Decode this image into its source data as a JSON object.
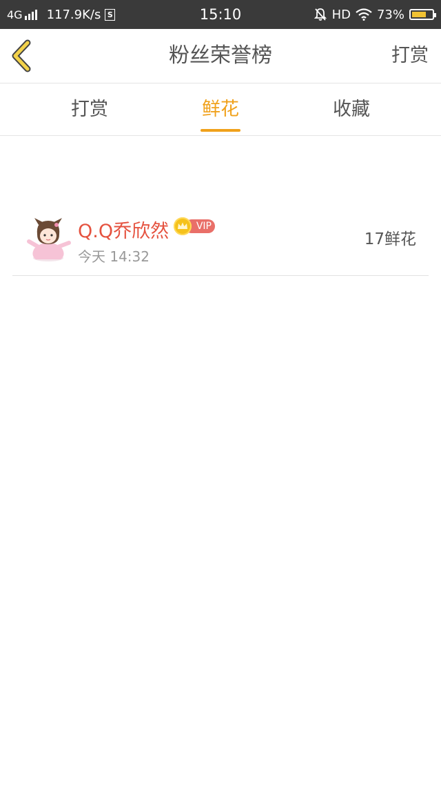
{
  "status_bar": {
    "network": "4G",
    "speed": "117.9K/s",
    "s_icon": "S",
    "time": "15:10",
    "hd": "HD",
    "battery": "73%",
    "battery_level": 0.73
  },
  "nav": {
    "title": "粉丝荣誉榜",
    "action": "打赏",
    "back_icon": "chevron-left-icon",
    "back_color": "#f3d24a"
  },
  "tabs": [
    {
      "label": "打赏",
      "active": false
    },
    {
      "label": "鲜花",
      "active": true
    },
    {
      "label": "收藏",
      "active": false
    }
  ],
  "list": [
    {
      "name": "Q.Q乔欣然",
      "badge": "VIP",
      "time": "今天 14:32",
      "count": "17鲜花"
    }
  ],
  "colors": {
    "accent": "#f0a11b",
    "name": "#e5523f",
    "status_bar_bg": "#3a3a3a",
    "vip_pill": "#e96f68",
    "crown": "#f5c21b"
  }
}
